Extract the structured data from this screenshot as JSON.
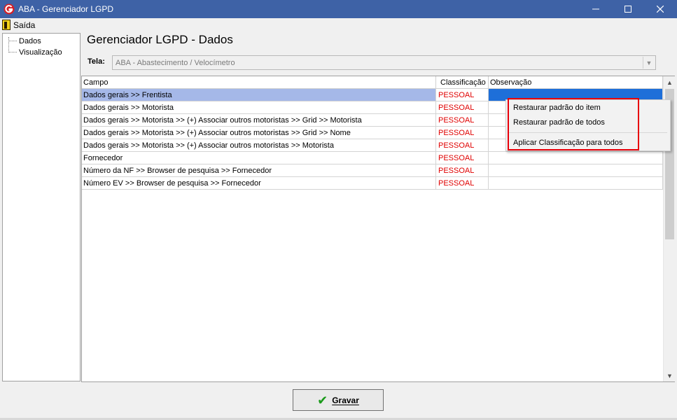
{
  "window": {
    "title": "ABA - Gerenciador LGPD",
    "minimize": "—",
    "maximize": "☐",
    "close": "✕"
  },
  "menu": {
    "exit_label": "Saída"
  },
  "tree": {
    "items": [
      "Dados",
      "Visualização"
    ]
  },
  "page": {
    "title": "Gerenciador LGPD - Dados",
    "tela_label": "Tela:",
    "tela_value": "ABA - Abastecimento / Velocímetro"
  },
  "grid": {
    "columns": [
      "Campo",
      "Classificação",
      "Observação"
    ],
    "rows": [
      {
        "campo": "Dados gerais >> Frentista",
        "classificacao": "PESSOAL",
        "observacao": ""
      },
      {
        "campo": "Dados gerais >> Motorista",
        "classificacao": "PESSOAL",
        "observacao": ""
      },
      {
        "campo": "Dados gerais >> Motorista >> (+) Associar outros motoristas >> Grid >> Motorista",
        "classificacao": "PESSOAL",
        "observacao": ""
      },
      {
        "campo": "Dados gerais >> Motorista >> (+) Associar outros motoristas >> Grid >> Nome",
        "classificacao": "PESSOAL",
        "observacao": ""
      },
      {
        "campo": "Dados gerais >> Motorista >> (+) Associar outros motoristas >> Motorista",
        "classificacao": "PESSOAL",
        "observacao": ""
      },
      {
        "campo": "Fornecedor",
        "classificacao": "PESSOAL",
        "observacao": ""
      },
      {
        "campo": "Número da NF >> Browser de pesquisa >> Fornecedor",
        "classificacao": "PESSOAL",
        "observacao": ""
      },
      {
        "campo": "Número EV >> Browser de pesquisa >> Fornecedor",
        "classificacao": "PESSOAL",
        "observacao": ""
      }
    ]
  },
  "context_menu": {
    "items": [
      "Restaurar padrão do item",
      "Restaurar padrão de todos",
      "Aplicar Classificação para todos"
    ]
  },
  "footer": {
    "save_label": "Gravar"
  },
  "colors": {
    "titlebar": "#3e62a6",
    "selection": "#a5b8e8",
    "selection_obs": "#1e6fd9",
    "classification_text": "#e00000",
    "highlight": "#e8000a"
  }
}
